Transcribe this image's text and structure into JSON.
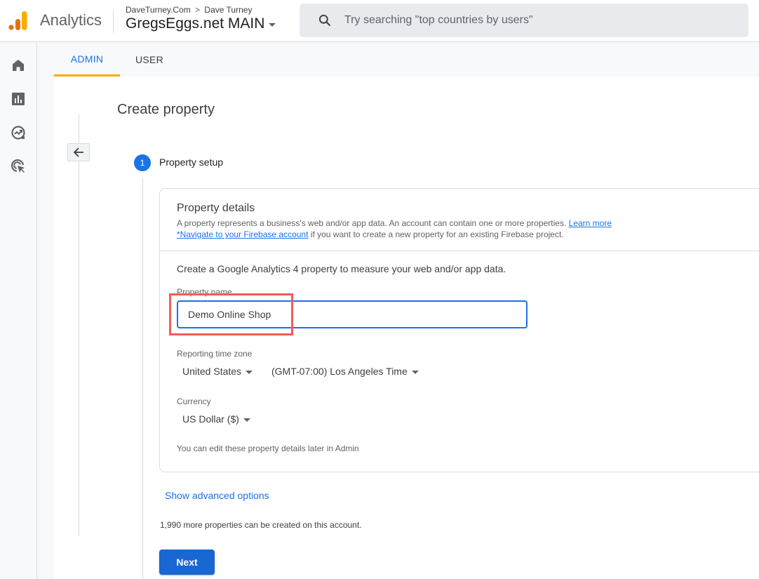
{
  "header": {
    "product_name": "Analytics",
    "breadcrumb": {
      "account": "DaveTurney.Com",
      "separator": ">",
      "user": "Dave Turney"
    },
    "property_selector": "GregsEggs.net MAIN",
    "search_placeholder": "Try searching \"top countries by users\"",
    "logo_colors": [
      "#e37400",
      "#e37400",
      "#f9ab00"
    ]
  },
  "leftnav": {
    "items": [
      {
        "name": "home",
        "icon": "home-icon"
      },
      {
        "name": "reports",
        "icon": "bar-chart-icon"
      },
      {
        "name": "explore",
        "icon": "explore-icon"
      },
      {
        "name": "advertising",
        "icon": "target-cursor-icon"
      }
    ]
  },
  "tabs": [
    {
      "label": "ADMIN",
      "active": true
    },
    {
      "label": "USER",
      "active": false
    }
  ],
  "page": {
    "title": "Create property",
    "step": {
      "number": "1",
      "label": "Property setup"
    },
    "card": {
      "title": "Property details",
      "desc_line1": "A property represents a business's web and/or app data. An account can contain one or more properties.",
      "learn_more": "Learn more",
      "firebase_link": "*Navigate to your Firebase account",
      "desc_line2_rest": " if you want to create a new property for an existing Firebase project.",
      "intro": "Create a Google Analytics 4 property to measure your web and/or app data.",
      "property_name_label": "Property name",
      "property_name_value": "Demo Online Shop",
      "timezone_label": "Reporting time zone",
      "country": "United States",
      "timezone": "(GMT-07:00) Los Angeles Time",
      "currency_label": "Currency",
      "currency": "US Dollar ($)",
      "hint": "You can edit these property details later in Admin"
    },
    "advanced_link": "Show advanced options",
    "quota_text": "1,990 more properties can be created on this account.",
    "next_label": "Next"
  },
  "colors": {
    "accent": "#1a73e8",
    "tab_indicator": "#f9ab00",
    "highlight_box": "#ee5d5d",
    "next_button": "#1967d2"
  }
}
